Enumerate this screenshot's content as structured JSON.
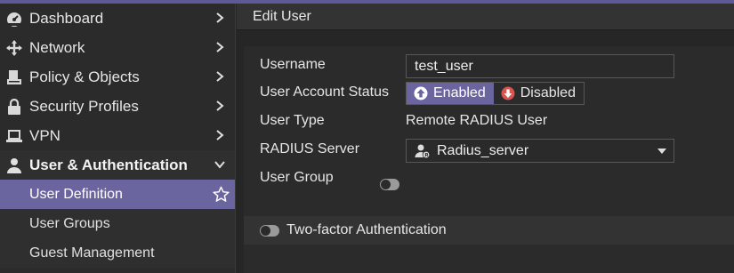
{
  "sidebar": {
    "items": [
      {
        "label": "Dashboard",
        "icon": "dashboard-gauge-icon"
      },
      {
        "label": "Network",
        "icon": "network-arrows-icon"
      },
      {
        "label": "Policy & Objects",
        "icon": "policy-objects-icon"
      },
      {
        "label": "Security Profiles",
        "icon": "lock-icon"
      },
      {
        "label": "VPN",
        "icon": "laptop-icon"
      },
      {
        "label": "User & Authentication",
        "icon": "user-icon",
        "expanded": true
      }
    ],
    "subitems": [
      {
        "label": "User Definition",
        "active": true
      },
      {
        "label": "User Groups"
      },
      {
        "label": "Guest Management"
      }
    ]
  },
  "main": {
    "title": "Edit User",
    "form": {
      "username_label": "Username",
      "username_value": "test_user",
      "status_label": "User Account Status",
      "status_options": [
        "Enabled",
        "Disabled"
      ],
      "status_selected": "Enabled",
      "usertype_label": "User Type",
      "usertype_value": "Remote RADIUS User",
      "radius_label": "RADIUS Server",
      "radius_value": "Radius_server",
      "usergroup_label": "User Group",
      "usergroup_enabled": false
    },
    "twofactor_label": "Two-factor Authentication",
    "twofactor_enabled": false
  },
  "colors": {
    "accent": "#6a659e",
    "enabled_icon": "#ffffff",
    "disabled_icon": "#d9534f"
  }
}
